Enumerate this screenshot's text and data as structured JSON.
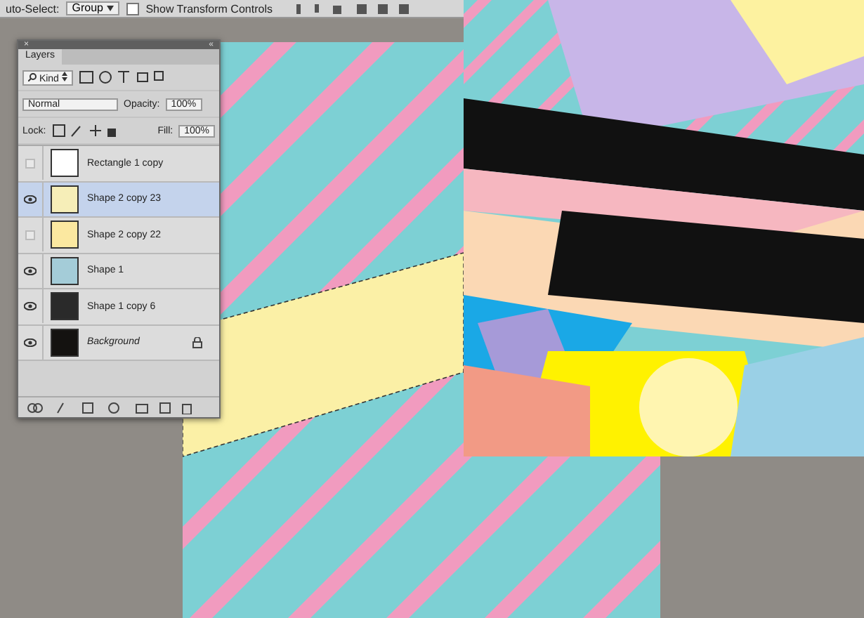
{
  "options_bar": {
    "auto_select_label": "uto-Select:",
    "auto_select_value": "Group",
    "show_transform_controls": {
      "label": "Show Transform Controls",
      "checked": false
    }
  },
  "layers_panel": {
    "close": "×",
    "collapse": "«",
    "tab": "Layers",
    "filter": "Kind",
    "blend_mode": "Normal",
    "opacity_label": "Opacity:",
    "opacity": "100%",
    "lock_label": "Lock:",
    "fill_label": "Fill:",
    "fill": "100%",
    "layers": [
      {
        "name": "Rectangle 1 copy",
        "visible": false,
        "selected": false,
        "locked": false,
        "kind": "layer",
        "color": "#ffffff"
      },
      {
        "name": "Shape 2 copy 23",
        "visible": true,
        "selected": true,
        "locked": false,
        "kind": "layer",
        "color": "#f6eeb8"
      },
      {
        "name": "Shape 2 copy 22",
        "visible": false,
        "selected": false,
        "locked": false,
        "kind": "layer",
        "color": "#fbe8a0"
      },
      {
        "name": "Shape 1",
        "visible": true,
        "selected": false,
        "locked": false,
        "kind": "layer",
        "color": "#a4ccd8"
      },
      {
        "name": "Shape 1 copy 6",
        "visible": true,
        "selected": false,
        "locked": false,
        "kind": "layer",
        "color": "#2a2a2a"
      },
      {
        "name": "Background",
        "visible": true,
        "selected": false,
        "locked": true,
        "kind": "background",
        "color": "#141210"
      }
    ]
  }
}
